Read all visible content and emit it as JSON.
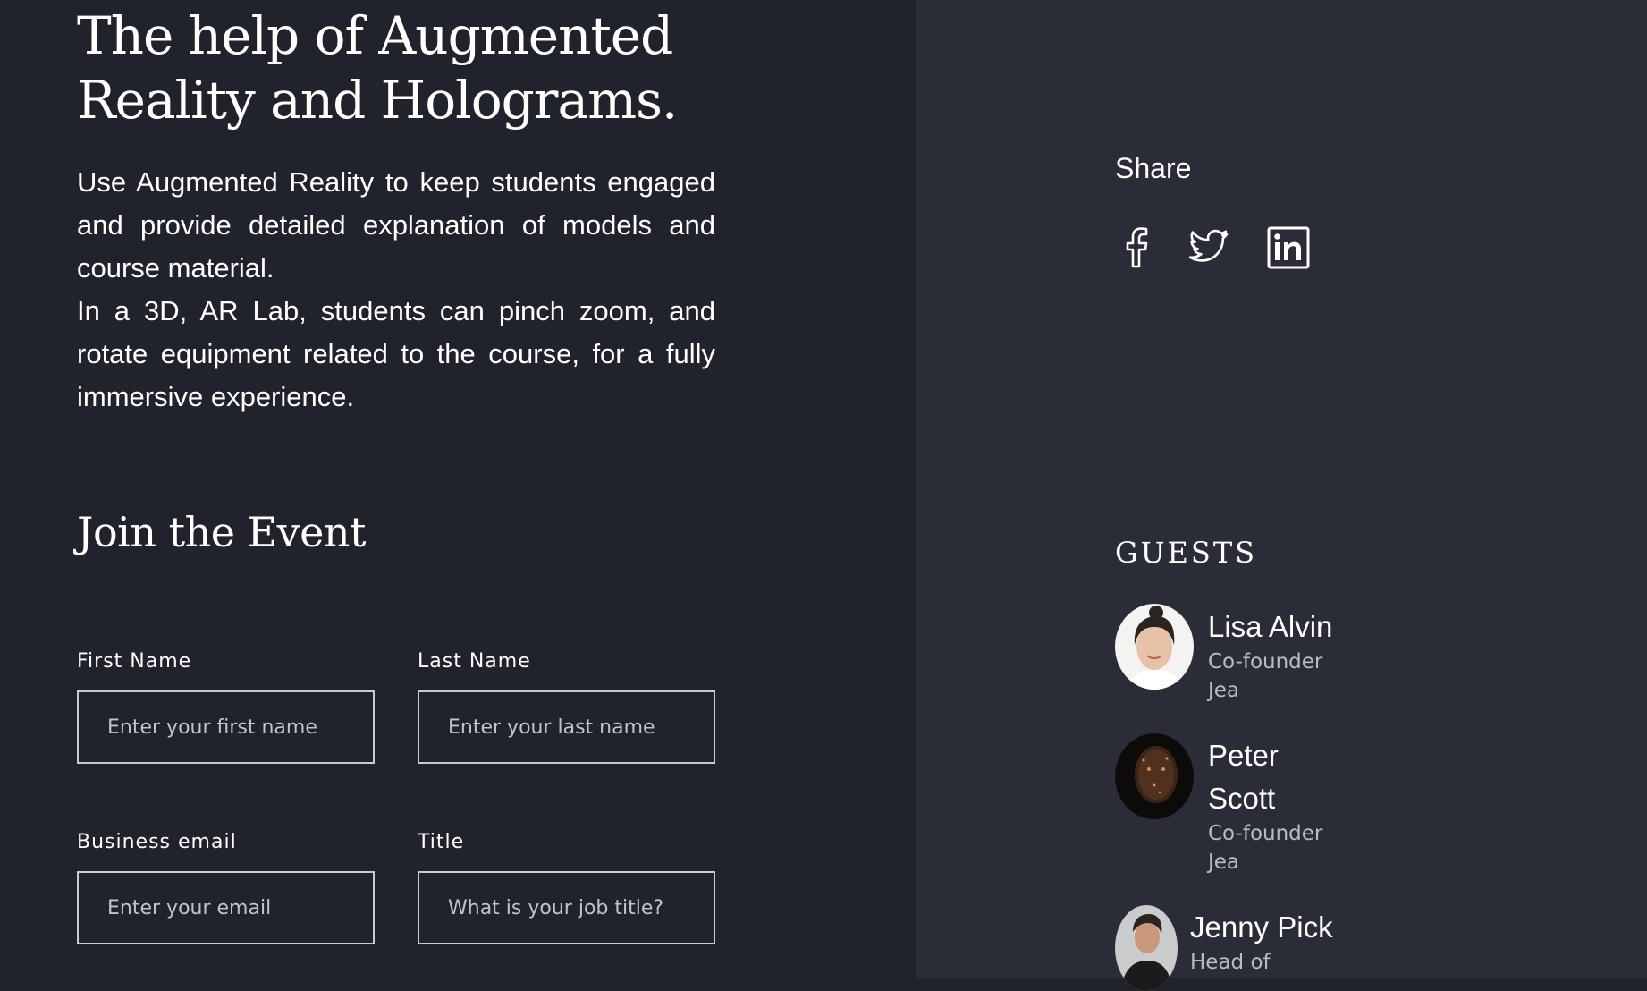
{
  "hero": {
    "title_line1": "The help of Augmented",
    "title_line2": "Reality and Holograms.",
    "paragraph1": "Use Augmented Reality to keep students engaged and provide detailed explanation of models and course material.",
    "paragraph2": "In a 3D, AR Lab, students can pinch zoom, and rotate equipment related to the course, for a fully immersive experience."
  },
  "form": {
    "title": "Join the Event",
    "first_name": {
      "label": "First Name",
      "placeholder": "Enter your first name"
    },
    "last_name": {
      "label": "Last Name",
      "placeholder": "Enter your last name"
    },
    "email": {
      "label": "Business email",
      "placeholder": "Enter your email"
    },
    "job_title": {
      "label": "Title",
      "placeholder": "What is your job title?"
    }
  },
  "share": {
    "label": "Share",
    "icons": [
      "facebook-icon",
      "twitter-icon",
      "linkedin-icon"
    ]
  },
  "guests": {
    "heading": "GUESTS",
    "list": [
      {
        "name": "Lisa Alvin",
        "role_line1": "Co-founder",
        "role_line2": "Jea"
      },
      {
        "name_line1": "Peter",
        "name_line2": "Scott",
        "role_line1": "Co-founder",
        "role_line2": "Jea"
      },
      {
        "name": "Jenny Pick",
        "role_line1": "Head of"
      }
    ]
  },
  "colors": {
    "left_background": "#20222c",
    "right_background": "#2a2d37",
    "text": "#ffffff",
    "muted_text": "#b9bcc4",
    "input_border": "#c9cbd2"
  }
}
